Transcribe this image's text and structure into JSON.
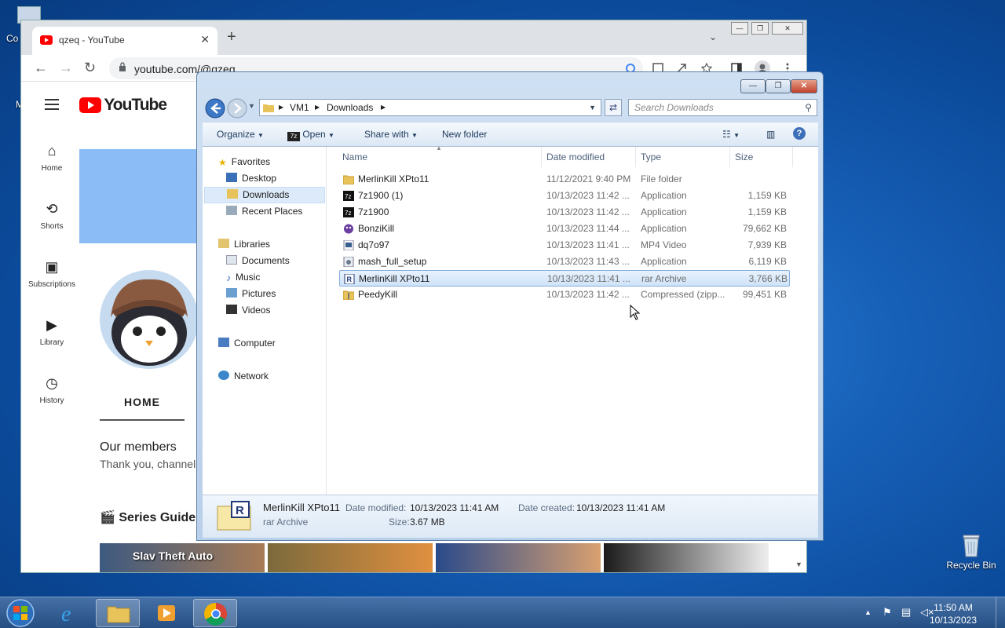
{
  "desktop": {
    "recycle_bin_label": "Recycle Bin",
    "partial_label_1": "Co",
    "partial_label_2": "M"
  },
  "chrome": {
    "tab_title": "qzeq - YouTube",
    "tab_close": "✕",
    "new_tab": "+",
    "tab_list": "⌄",
    "url": "youtube.com/@qzeq",
    "back": "←",
    "forward": "→",
    "reload": "↻",
    "minimize": "—",
    "restore": "❐",
    "close": "✕"
  },
  "youtube": {
    "logo_text": "YouTube",
    "sidebar": [
      {
        "label": "Home",
        "icon": "⌂"
      },
      {
        "label": "Shorts",
        "icon": "⟲"
      },
      {
        "label": "Subscriptions",
        "icon": "▣"
      },
      {
        "label": "Library",
        "icon": "▶"
      },
      {
        "label": "History",
        "icon": "◷"
      }
    ],
    "home_tab": "HOME",
    "members_title": "Our members",
    "members_sub": "Thank you, channel",
    "series_title": "🎬 Series Guide 🎬",
    "thumbnails": [
      "Slav Theft Auto",
      "",
      "",
      ""
    ]
  },
  "explorer": {
    "caption_min": "—",
    "caption_max": "❐",
    "caption_close": "✕",
    "breadcrumb": [
      "VM1",
      "Downloads"
    ],
    "search_placeholder": "Search Downloads",
    "commands": {
      "organize": "Organize",
      "open": "Open",
      "share": "Share with",
      "new_folder": "New folder"
    },
    "nav": {
      "favorites": "Favorites",
      "desktop": "Desktop",
      "downloads": "Downloads",
      "recent": "Recent Places",
      "libraries": "Libraries",
      "documents": "Documents",
      "music": "Music",
      "pictures": "Pictures",
      "videos": "Videos",
      "computer": "Computer",
      "network": "Network"
    },
    "columns": {
      "name": "Name",
      "date": "Date modified",
      "type": "Type",
      "size": "Size"
    },
    "files": [
      {
        "name": "MerlinKill XPto11",
        "date": "11/12/2021 9:40 PM",
        "type": "File folder",
        "size": "",
        "icon": "folder-icon"
      },
      {
        "name": "7z1900 (1)",
        "date": "10/13/2023 11:42 ...",
        "type": "Application",
        "size": "1,159 KB",
        "icon": "7zip-icon"
      },
      {
        "name": "7z1900",
        "date": "10/13/2023 11:42 ...",
        "type": "Application",
        "size": "1,159 KB",
        "icon": "7zip-icon"
      },
      {
        "name": "BonziKill",
        "date": "10/13/2023 11:44 ...",
        "type": "Application",
        "size": "79,662 KB",
        "icon": "bonzi-icon"
      },
      {
        "name": "dq7o97",
        "date": "10/13/2023 11:41 ...",
        "type": "MP4 Video",
        "size": "7,939 KB",
        "icon": "video-file-icon"
      },
      {
        "name": "mash_full_setup",
        "date": "10/13/2023 11:43 ...",
        "type": "Application",
        "size": "6,119 KB",
        "icon": "setup-icon"
      },
      {
        "name": "MerlinKill XPto11",
        "date": "10/13/2023 11:41 ...",
        "type": "rar Archive",
        "size": "3,766 KB",
        "icon": "rar-icon"
      },
      {
        "name": "PeedyKill",
        "date": "10/13/2023 11:42 ...",
        "type": "Compressed (zipp...",
        "size": "99,451 KB",
        "icon": "zip-folder-icon"
      }
    ],
    "details": {
      "name": "MerlinKill XPto11",
      "type": "rar Archive",
      "date_modified_label": "Date modified:",
      "date_modified": "10/13/2023 11:41 AM",
      "date_created_label": "Date created:",
      "date_created": "10/13/2023 11:41 AM",
      "size_label": "Size:",
      "size": "3.67 MB"
    }
  },
  "taskbar": {
    "time": "11:50 AM",
    "date": "10/13/2023",
    "tray_arrow": "▲"
  },
  "colors": {
    "accent": "#1760b8",
    "youtube_red": "#ff0000",
    "selection": "#cfe3f8"
  }
}
